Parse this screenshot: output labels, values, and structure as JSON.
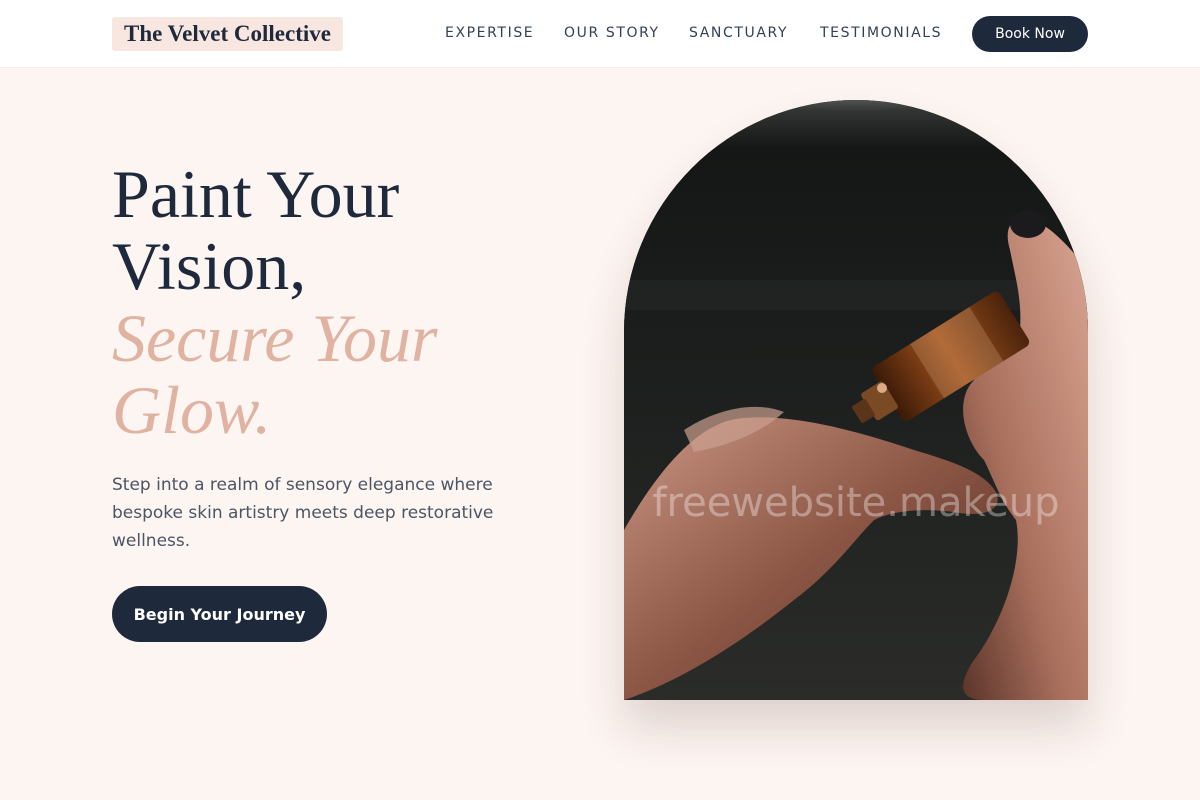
{
  "brand": {
    "name": "The Velvet Collective"
  },
  "nav": {
    "links": [
      "EXPERTISE",
      "OUR STORY",
      "SANCTUARY",
      "TESTIMONIALS"
    ],
    "cta_label": "Book Now"
  },
  "hero": {
    "title_lines": [
      "Paint Your",
      "Vision,"
    ],
    "accent_lines": [
      "Secure Your",
      "Glow."
    ],
    "subtitle": "Step into a realm of sensory elegance where bespoke skin artistry meets deep restorative wellness.",
    "cta_label": "Begin Your Journey"
  },
  "image": {
    "watermark": "freewebsite.makeup"
  },
  "colors": {
    "background": "#fdf5f2",
    "navy": "#1e293b",
    "accent": "#e0b2a1",
    "logo_bg": "#f8e6e0"
  }
}
